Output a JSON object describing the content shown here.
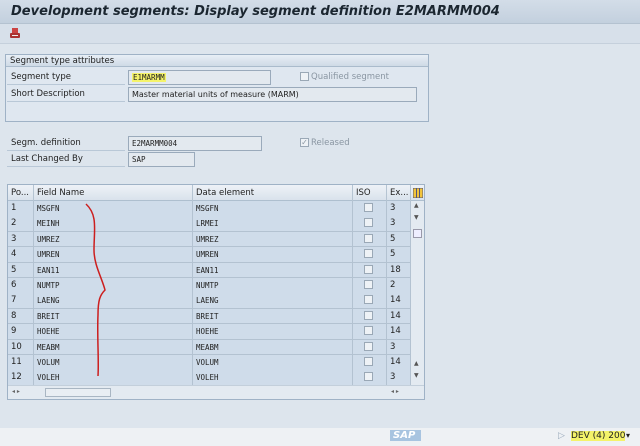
{
  "title": "Development segments: Display segment definition E2MARMM004",
  "toolbar": {
    "icons": [
      "where-used-icon"
    ]
  },
  "attributes": {
    "group_title": "Segment type attributes",
    "segment_type_label": "Segment type",
    "segment_type_value": "E1MARMM",
    "qualified_label": "Qualified segment",
    "qualified_checked": false,
    "short_desc_label": "Short Description",
    "short_desc_value": "Master material units of measure (MARM)"
  },
  "definition": {
    "segm_def_label": "Segm. definition",
    "segm_def_value": "E2MARMM004",
    "released_label": "Released",
    "released_checked": true,
    "last_changed_label": "Last Changed By",
    "last_changed_value": "SAP"
  },
  "table": {
    "headers": [
      "Po...",
      "Field Name",
      "Data element",
      "ISO c...",
      "Ex..."
    ],
    "rows": [
      {
        "pos": "1",
        "field": "MSGFN",
        "element": "MSGFN",
        "iso": false,
        "ext": "3"
      },
      {
        "pos": "2",
        "field": "MEINH",
        "element": "LRMEI",
        "iso": false,
        "ext": "3"
      },
      {
        "pos": "3",
        "field": "UMREZ",
        "element": "UMREZ",
        "iso": false,
        "ext": "5"
      },
      {
        "pos": "4",
        "field": "UMREN",
        "element": "UMREN",
        "iso": false,
        "ext": "5"
      },
      {
        "pos": "5",
        "field": "EAN11",
        "element": "EAN11",
        "iso": false,
        "ext": "18"
      },
      {
        "pos": "6",
        "field": "NUMTP",
        "element": "NUMTP",
        "iso": false,
        "ext": "2"
      },
      {
        "pos": "7",
        "field": "LAENG",
        "element": "LAENG",
        "iso": false,
        "ext": "14"
      },
      {
        "pos": "8",
        "field": "BREIT",
        "element": "BREIT",
        "iso": false,
        "ext": "14"
      },
      {
        "pos": "9",
        "field": "HOEHE",
        "element": "HOEHE",
        "iso": false,
        "ext": "14"
      },
      {
        "pos": "10",
        "field": "MEABM",
        "element": "MEABM",
        "iso": false,
        "ext": "3"
      },
      {
        "pos": "11",
        "field": "VOLUM",
        "element": "VOLUM",
        "iso": false,
        "ext": "14"
      },
      {
        "pos": "12",
        "field": "VOLEH",
        "element": "VOLEH",
        "iso": false,
        "ext": "3"
      }
    ]
  },
  "status": {
    "logo": "SAP",
    "system": "DEV (4) 200"
  },
  "colors": {
    "highlight": "#f4f36a",
    "annotation": "#cc1f1f"
  }
}
